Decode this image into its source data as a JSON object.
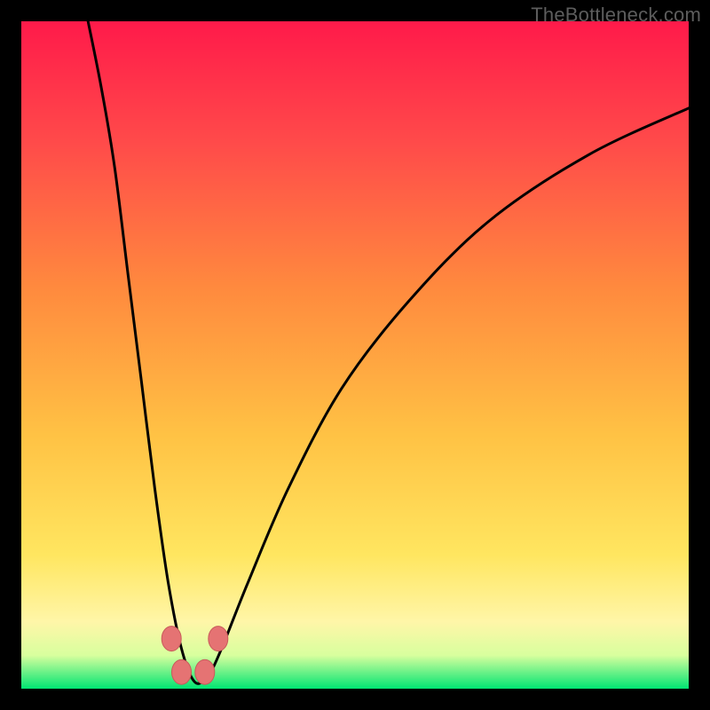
{
  "watermark": "TheBottleneck.com",
  "colors": {
    "page_bg": "#000000",
    "watermark_text": "#5d5d5d",
    "gradient_top": "#ff1744",
    "gradient_mid1": "#ff6d3a",
    "gradient_mid2": "#ffb03a",
    "gradient_mid3": "#ffe24a",
    "gradient_bottom_yellow": "#fff59d",
    "gradient_bottom_green": "#00e676",
    "curve": "#000000",
    "marker_fill": "#e57373",
    "marker_stroke": "#c85a5a"
  },
  "chart_data": {
    "type": "line",
    "title": "",
    "xlabel": "",
    "ylabel": "",
    "x_range": [
      0,
      100
    ],
    "y_range": [
      0,
      100
    ],
    "minimum_x": 26,
    "curve_points": [
      {
        "x": 10,
        "y": 100
      },
      {
        "x": 12,
        "y": 90
      },
      {
        "x": 14,
        "y": 78
      },
      {
        "x": 16,
        "y": 62
      },
      {
        "x": 18,
        "y": 46
      },
      {
        "x": 20,
        "y": 30
      },
      {
        "x": 22,
        "y": 16
      },
      {
        "x": 24,
        "y": 6
      },
      {
        "x": 26,
        "y": 1
      },
      {
        "x": 28,
        "y": 2
      },
      {
        "x": 30,
        "y": 6
      },
      {
        "x": 34,
        "y": 16
      },
      {
        "x": 40,
        "y": 30
      },
      {
        "x": 48,
        "y": 45
      },
      {
        "x": 58,
        "y": 58
      },
      {
        "x": 70,
        "y": 70
      },
      {
        "x": 85,
        "y": 80
      },
      {
        "x": 100,
        "y": 87
      }
    ],
    "markers": [
      {
        "x": 22.5,
        "y": 7.5
      },
      {
        "x": 24.0,
        "y": 2.5
      },
      {
        "x": 27.5,
        "y": 2.5
      },
      {
        "x": 29.5,
        "y": 7.5
      }
    ],
    "gradient_stops_pct": [
      0,
      20,
      45,
      65,
      82,
      92,
      96,
      100
    ]
  }
}
